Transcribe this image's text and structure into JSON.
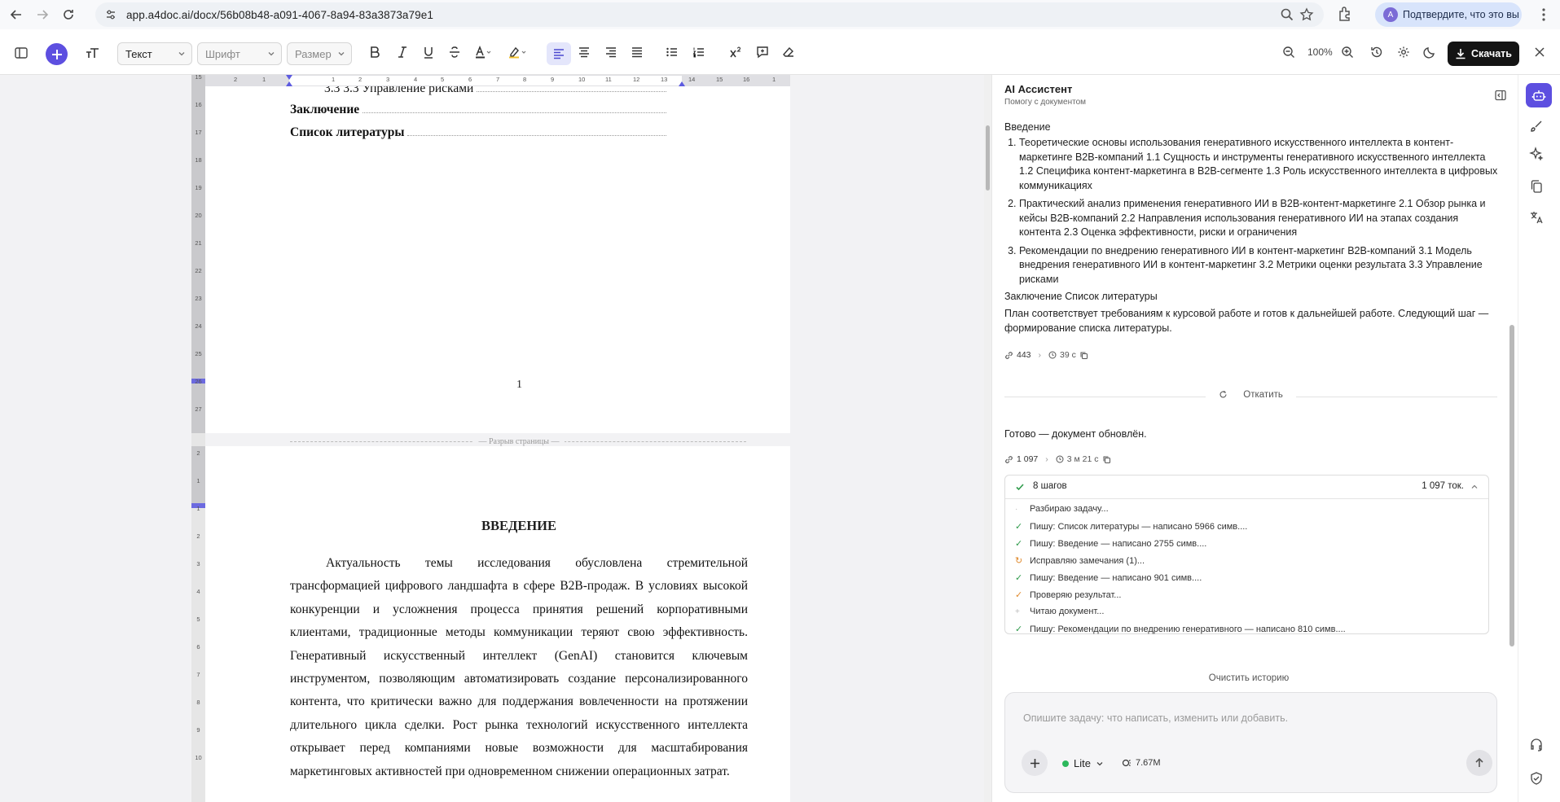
{
  "browser": {
    "url": "app.a4doc.ai/docx/56b08b48-a091-4067-8a94-83a3873a79e1",
    "verify_label": "Подтвердите, что это вы",
    "avatar_letter": "A"
  },
  "toolbar": {
    "style_select": "Текст",
    "font_select": "Шрифт",
    "size_select": "Размер",
    "zoom": "100%",
    "download_label": "Скачать",
    "accent": "#5d4fe0"
  },
  "document": {
    "toc": [
      {
        "label": "3.3 3.3 Управление рисками",
        "bold": false
      },
      {
        "label": "Заключение",
        "bold": true
      },
      {
        "label": "Список литературы",
        "bold": true
      }
    ],
    "page_number": "1",
    "page_break_label": "— Разрыв страницы —",
    "intro_heading": "ВВЕДЕНИЕ",
    "intro_paragraph": "Актуальность темы исследования обусловлена стремительной трансформацией цифрового ландшафта в сфере B2B-продаж. В условиях высокой конкуренции и усложнения процесса принятия решений корпоративными клиентами, традиционные методы коммуникации теряют свою эффективность. Генеративный искусственный интеллект (GenAI) становится ключевым инструментом, позволяющим автоматизировать создание персонализированного контента, что критически важно для поддержания вовлеченности на протяжении длительного цикла сделки. Рост рынка технологий искусственного интеллекта открывает перед компаниями новые возможности для масштабирования маркетинговых активностей при одновременном снижении операционных затрат.",
    "hruler_labels": [
      "2",
      "1",
      "1",
      "2",
      "3",
      "4",
      "5",
      "6",
      "7",
      "8",
      "9",
      "10",
      "11",
      "12",
      "13",
      "14",
      "15",
      "16",
      "1"
    ],
    "vruler_top": [
      "15",
      "16",
      "17",
      "18",
      "19",
      "20",
      "21",
      "22",
      "23",
      "24",
      "25",
      "26",
      "27"
    ],
    "vruler_bottom": [
      "2",
      "1",
      "1",
      "2",
      "3",
      "4",
      "5",
      "6",
      "7",
      "8",
      "9",
      "10"
    ]
  },
  "assistant": {
    "title": "AI Ассистент",
    "subtitle": "Помогу с документом",
    "intro_line": "Введение",
    "plan_items": [
      "Теоретические основы использования генеративного искусственного интеллекта в контент-маркетинге B2B-компаний 1.1 Сущность и инструменты генеративного искусственного интеллекта 1.2 Специфика контент-маркетинга в B2B-сегменте 1.3 Роль искусственного интеллекта в цифровых коммуникациях",
      "Практический анализ применения генеративного ИИ в B2B-контент-маркетинге 2.1 Обзор рынка и кейсы B2B-компаний 2.2 Направления использования генеративного ИИ на этапах создания контента 2.3 Оценка эффективности, риски и ограничения",
      "Рекомендации по внедрению генеративного ИИ в контент-маркетинг B2B-компаний 3.1 Модель внедрения генеративного ИИ в контент-маркетинг 3.2 Метрики оценки результата 3.3 Управление рисками"
    ],
    "closing_line": "Заключение Список литературы",
    "summary": "План соответствует требованиям к курсовой работе и готов к дальнейшей работе. Следующий шаг — формирование списка литературы.",
    "meta1": {
      "tokens": "443",
      "time": "39 с"
    },
    "revert_label": "Откатить",
    "done_text": "Готово — документ обновлён.",
    "meta2": {
      "tokens": "1 097",
      "time": "3 м 21 с"
    },
    "steps_header": {
      "label": "8 шагов",
      "tokens": "1 097 ток."
    },
    "steps": [
      {
        "status": "pending",
        "text": "Разбираю задачу..."
      },
      {
        "status": "done",
        "text": "Пишу: Список литературы — написано 5966 симв...."
      },
      {
        "status": "done",
        "text": "Пишу: Введение — написано 2755 симв...."
      },
      {
        "status": "retry",
        "text": "Исправляю замечания (1)..."
      },
      {
        "status": "done",
        "text": "Пишу: Введение — написано 901 симв...."
      },
      {
        "status": "check",
        "text": "Проверяю результат..."
      },
      {
        "status": "pending",
        "text": "Читаю документ..."
      },
      {
        "status": "done",
        "text": "Пишу: Рекомендации по внедрению генеративного — написано 810 симв...."
      }
    ],
    "clear_history": "Очистить историю",
    "input_placeholder": "Опишите задачу: что написать, изменить или добавить.",
    "model": "Lite",
    "token_balance": "7.67M"
  }
}
